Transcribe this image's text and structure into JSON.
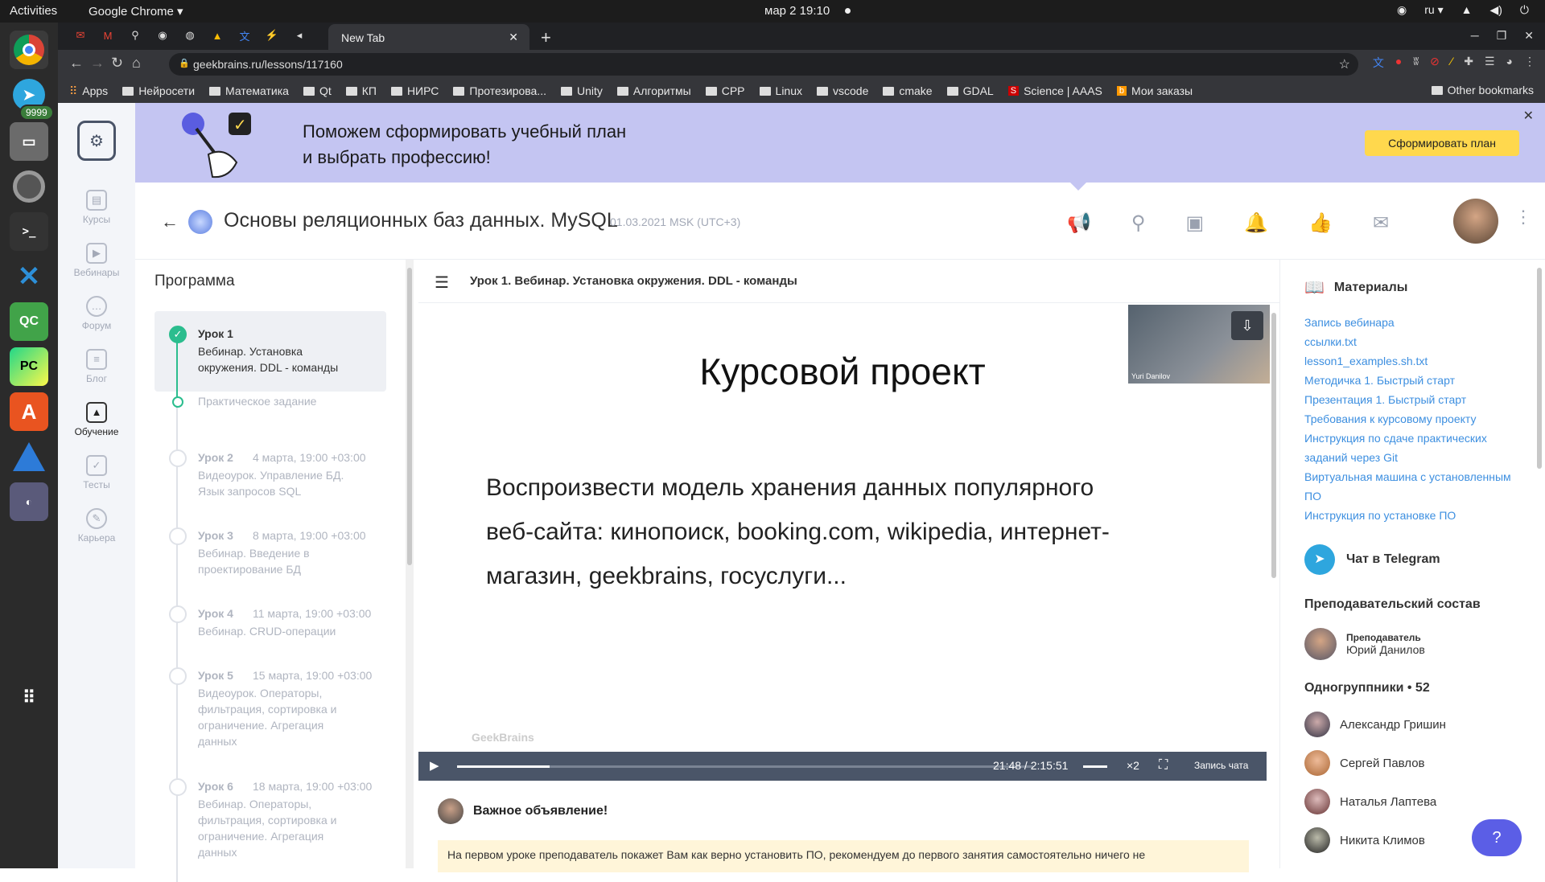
{
  "os": {
    "activities": "Activities",
    "app_name": "Google Chrome ▾",
    "clock": "мар 2  19:10",
    "lang": "ru ▾"
  },
  "dock": {
    "telegram_badge": "9999"
  },
  "browser": {
    "tab_title": "New Tab",
    "url": "geekbrains.ru/lessons/117160",
    "bookmarks": [
      "Apps",
      "Нейросети",
      "Математика",
      "Qt",
      "КП",
      "НИРС",
      "Протезирова...",
      "Unity",
      "Алгоритмы",
      "CPP",
      "Linux",
      "vscode",
      "cmake",
      "GDAL",
      "Science | AAAS",
      "Мои заказы"
    ],
    "other_bookmarks": "Other bookmarks"
  },
  "nav": {
    "items": [
      {
        "label": "Курсы",
        "icon": "book-icon"
      },
      {
        "label": "Вебинары",
        "icon": "video-icon"
      },
      {
        "label": "Форум",
        "icon": "chat-icon"
      },
      {
        "label": "Блог",
        "icon": "blog-icon"
      },
      {
        "label": "Обучение",
        "icon": "graduation-cap-icon"
      },
      {
        "label": "Тесты",
        "icon": "checkbox-icon"
      },
      {
        "label": "Карьера",
        "icon": "career-icon"
      }
    ]
  },
  "banner": {
    "line1": "Поможем сформировать учебный план",
    "line2": "и выбрать профессию!",
    "button": "Сформировать план"
  },
  "course": {
    "title": "Основы реляционных баз данных. MySQL",
    "date": "01.03.2021 MSK (UTC+3)"
  },
  "program": {
    "title": "Программа",
    "lessons": [
      {
        "num": "Урок 1",
        "date": "",
        "desc": "Вебинар. Установка окружения. DDL - команды"
      },
      {
        "num": "Практическое задание",
        "date": "",
        "desc": ""
      },
      {
        "num": "Урок 2",
        "date": "4 марта, 19:00 +03:00",
        "desc": "Видеоурок. Управление БД. Язык запросов SQL"
      },
      {
        "num": "Урок 3",
        "date": "8 марта, 19:00 +03:00",
        "desc": "Вебинар. Введение в проектирование БД"
      },
      {
        "num": "Урок 4",
        "date": "11 марта, 19:00 +03:00",
        "desc": "Вебинар. CRUD-операции"
      },
      {
        "num": "Урок 5",
        "date": "15 марта, 19:00 +03:00",
        "desc": "Видеоурок. Операторы, фильтрация, сортировка и ограничение. Агрегация данных"
      },
      {
        "num": "Урок 6",
        "date": "18 марта, 19:00 +03:00",
        "desc": "Вебинар. Операторы, фильтрация, сортировка и ограничение. Агрегация данных"
      }
    ]
  },
  "lesson": {
    "header": "Урок 1. Вебинар. Установка окружения. DDL - команды",
    "slide_title": "Курсовой проект",
    "slide_body": "Воспроизвести модель хранения данных популярного веб-сайта: кинопоиск, booking.com, wikipedia, интернет-магазин, geekbrains, госуслуги...",
    "watermark": "GeekBrains",
    "speaker": "Yuri Danilov",
    "time": "21:48 / 2:15:51",
    "speed": "×2",
    "chat_record": "Запись чата",
    "progress": 0.16
  },
  "announcement": {
    "title": "Важное объявление!",
    "text": "На первом уроке преподаватель покажет Вам как верно установить ПО, рекомендуем до первого занятия самостоятельно ничего не"
  },
  "materials": {
    "title": "Материалы",
    "links": [
      "Запись вебинара",
      "ссылки.txt",
      "lesson1_examples.sh.txt",
      "Методичка 1. Быстрый старт",
      "Презентация 1. Быстрый старт",
      "Требования к курсовому проекту",
      "Инструкция по сдаче практических заданий через Git",
      "Виртуальная машина с установленным ПО",
      "Инструкция по установке ПО"
    ],
    "telegram": "Чат в Telegram",
    "staff_title": "Преподавательский состав",
    "teacher_role": "Преподаватель",
    "teacher_name": "Юрий Данилов",
    "groupmates_title": "Одногруппники • 52",
    "groupmates": [
      "Александр Гришин",
      "Сергей Павлов",
      "Наталья Лаптева",
      "Никита Климов"
    ]
  }
}
